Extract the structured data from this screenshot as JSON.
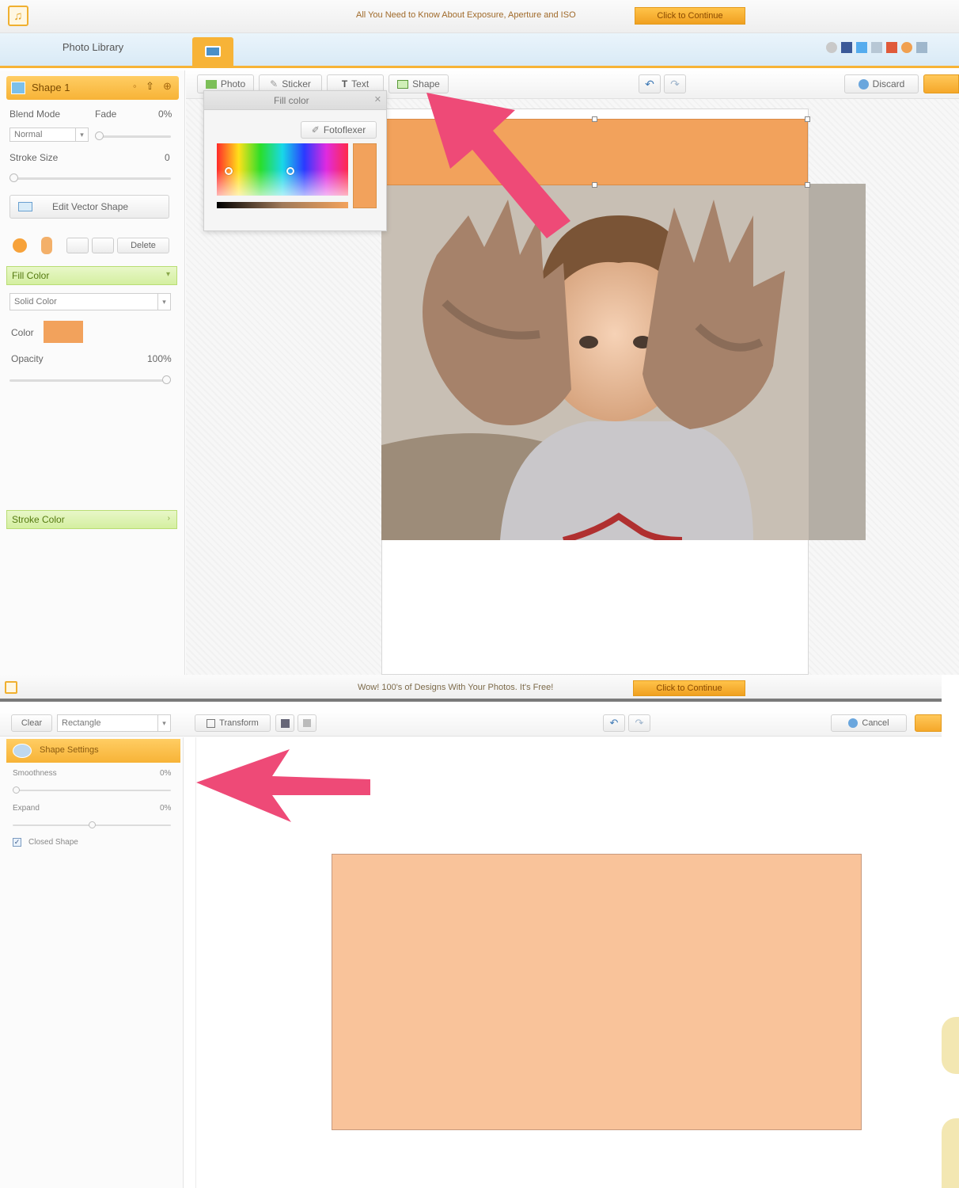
{
  "top": {
    "ad_text": "All You Need to Know About Exposure, Aperture and ISO",
    "ad_button": "Click to Continue",
    "library_tab": "Photo Library",
    "layer": {
      "name": "Shape 1"
    },
    "props": {
      "blend_mode_label": "Blend Mode",
      "fade_label": "Fade",
      "fade_value": "0%",
      "blend_value": "Normal",
      "stroke_size_label": "Stroke Size",
      "stroke_size_value": "0",
      "edit_vector_label": "Edit Vector Shape",
      "delete_label": "Delete"
    },
    "fill": {
      "section": "Fill Color",
      "type_value": "Solid Color",
      "color_label": "Color",
      "swatch_color": "#f2a25c",
      "opacity_label": "Opacity",
      "opacity_value": "100%"
    },
    "stroke_section": "Stroke Color",
    "toolbar": {
      "photo": "Photo",
      "sticker": "Sticker",
      "text": "Text",
      "shape": "Shape",
      "discard": "Discard"
    },
    "popup": {
      "title": "Fill color",
      "picker_label": "Fotoflexer",
      "current_color": "#f2a25c"
    }
  },
  "bottom": {
    "ad_text": "Wow! 100's of Designs With Your Photos. It's Free!",
    "ad_button": "Click to Continue",
    "clear_label": "Clear",
    "shape_select": "Rectangle",
    "transform_label": "Transform",
    "cancel_label": "Cancel",
    "panel_title": "Shape Settings",
    "smoothness_label": "Smoothness",
    "smoothness_value": "0%",
    "expand_label": "Expand",
    "expand_value": "0%",
    "closed_shape_label": "Closed Shape",
    "closed_shape_checked": true,
    "rect_color": "#f9c39a"
  },
  "colors": {
    "accent_orange": "#f7b337",
    "annotation_arrow": "#ee4a77",
    "section_green": "#d4efa0"
  }
}
